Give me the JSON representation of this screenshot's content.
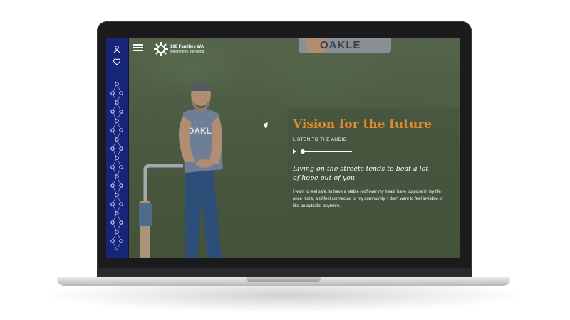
{
  "site": {
    "title": "100 Families WA",
    "subtitle": "welcome to our world"
  },
  "sidebar": {
    "icons": [
      "user-icon",
      "heart-icon"
    ],
    "color": "#162578"
  },
  "hero": {
    "shirt_text": "OAKL",
    "top_shirt_text": "OAKLE"
  },
  "content": {
    "title": "Vision for the future",
    "listen_label": "LISTEN TO THE AUDIO",
    "audio_progress": 0.02,
    "quote": "Living on the streets tends to beat a lot of hope out of you.",
    "body": "I want to feel safe, to have a stable roof over my head, have purpose in my life once more, and feel connected to my community. I don't want to feel invisible or like an outsider anymore."
  },
  "colors": {
    "accent": "#e08a2c",
    "background": "#4b5a43"
  }
}
